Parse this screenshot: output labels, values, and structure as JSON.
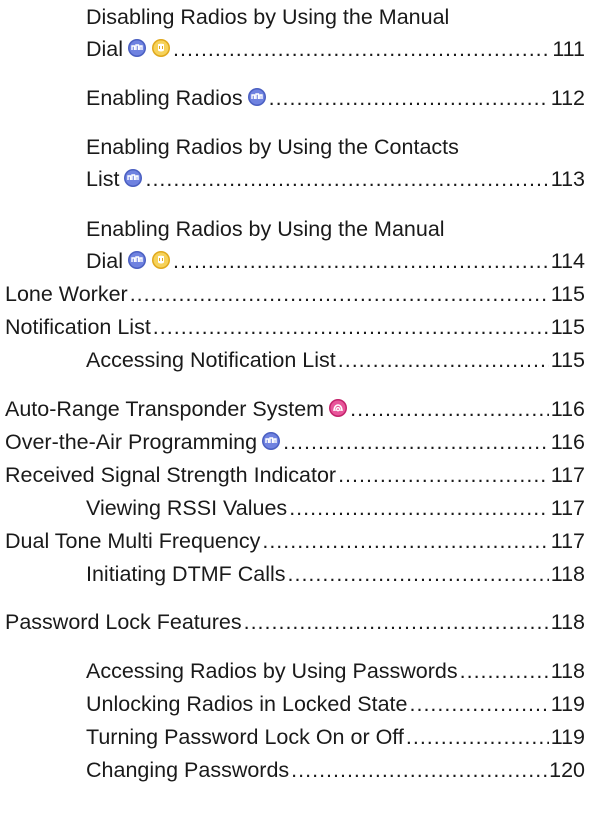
{
  "toc": {
    "entries": [
      {
        "line1": "Disabling Radios by Using the Manual",
        "line2": "Dial",
        "page": "111",
        "icons": [
          "digital-icon",
          "analog-icon"
        ]
      },
      {
        "line1": "Enabling Radios",
        "page": "112",
        "icons": [
          "digital-icon"
        ]
      },
      {
        "line1": "Enabling Radios by Using the Contacts",
        "line2": "List",
        "page": "113",
        "icons": [
          "digital-icon"
        ]
      },
      {
        "line1": "Enabling Radios by Using the Manual",
        "line2": "Dial",
        "page": "114",
        "icons": [
          "digital-icon",
          "analog-icon"
        ]
      },
      {
        "line1": "Lone Worker",
        "page": "115"
      },
      {
        "line1": "Notification List",
        "page": "115"
      },
      {
        "line1": "Accessing Notification List",
        "page": "115"
      },
      {
        "line1": "Auto-Range Transponder System",
        "page": "116",
        "icons": [
          "ars-icon"
        ]
      },
      {
        "line1": "Over-the-Air Programming",
        "page": "116",
        "icons": [
          "digital-icon"
        ]
      },
      {
        "line1": "Received Signal Strength Indicator",
        "page": "117"
      },
      {
        "line1": "Viewing RSSI Values",
        "page": "117"
      },
      {
        "line1": "Dual Tone Multi Frequency",
        "page": "117"
      },
      {
        "line1": "Initiating DTMF Calls",
        "page": "118"
      },
      {
        "line1": "Password Lock Features",
        "page": "118"
      },
      {
        "line1": "Accessing Radios by Using Passwords",
        "page": "118"
      },
      {
        "line1": "Unlocking Radios in Locked State",
        "page": "119"
      },
      {
        "line1": "Turning Password Lock On or Off",
        "page": "119"
      },
      {
        "line1": "Changing Passwords",
        "page": "120"
      }
    ]
  },
  "colors": {
    "digital_icon": "#4a5fc1",
    "analog_icon": "#f2c23a",
    "ars_icon": "#d6337a"
  }
}
